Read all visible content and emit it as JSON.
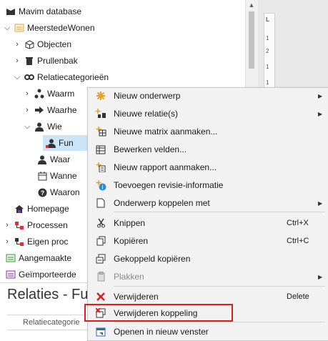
{
  "tree": {
    "root": "Mavim database",
    "items": [
      {
        "label": "MeerstedeWonen"
      },
      {
        "label": "Objecten"
      },
      {
        "label": "Prullenbak"
      },
      {
        "label": "Relatiecategorieën"
      },
      {
        "label": "Waarm"
      },
      {
        "label": "Waarhe"
      },
      {
        "label": "Wie"
      },
      {
        "label": "Fun"
      },
      {
        "label": "Waar"
      },
      {
        "label": "Wanne"
      },
      {
        "label": "Waaron"
      },
      {
        "label": "Homepage"
      },
      {
        "label": "Processen"
      },
      {
        "label": "Eigen proc"
      },
      {
        "label": "Aangemaakte"
      },
      {
        "label": "Geïmporteerde"
      }
    ]
  },
  "ruler": {
    "marks": [
      "L",
      "1",
      "2",
      "1",
      "1"
    ]
  },
  "bottom": {
    "title": "Relaties - Fu",
    "column": "Relatiecategorie"
  },
  "menu": {
    "items": [
      {
        "label": "Nieuw onderwerp",
        "shortcut": "",
        "submenu": true
      },
      {
        "label": "Nieuwe relatie(s)",
        "shortcut": "",
        "submenu": true
      },
      {
        "label": "Nieuwe matrix aanmaken...",
        "shortcut": "",
        "submenu": false
      },
      {
        "label": "Bewerken velden...",
        "shortcut": "",
        "submenu": false
      },
      {
        "label": "Nieuw rapport aanmaken...",
        "shortcut": "",
        "submenu": false
      },
      {
        "label": "Toevoegen revisie-informatie",
        "shortcut": "",
        "submenu": false
      },
      {
        "label": "Onderwerp koppelen met",
        "shortcut": "",
        "submenu": true
      },
      {
        "label": "Knippen",
        "shortcut": "Ctrl+X",
        "submenu": false
      },
      {
        "label": "Kopiëren",
        "shortcut": "Ctrl+C",
        "submenu": false
      },
      {
        "label": "Gekoppeld kopiëren",
        "shortcut": "",
        "submenu": false
      },
      {
        "label": "Plakken",
        "shortcut": "",
        "submenu": true
      },
      {
        "label": "Verwijderen",
        "shortcut": "Delete",
        "submenu": false
      },
      {
        "label": "Verwijderen koppeling",
        "shortcut": "",
        "submenu": false
      },
      {
        "label": "Openen in nieuw venster",
        "shortcut": "",
        "submenu": false
      }
    ]
  },
  "colors": {
    "highlight": "#e21b1b",
    "selection": "#cce4f7"
  }
}
